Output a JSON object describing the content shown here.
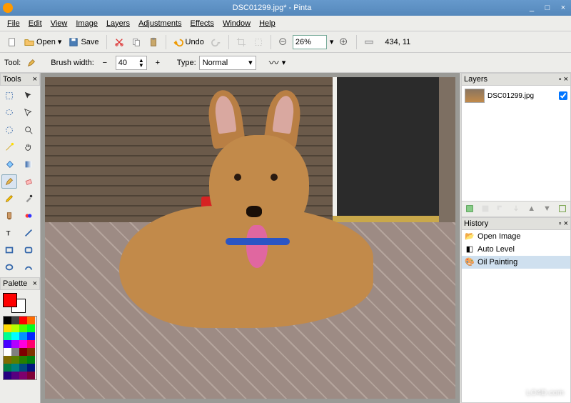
{
  "window": {
    "title": "DSC01299.jpg* - Pinta",
    "minimize": "_",
    "maximize": "□",
    "close": "×"
  },
  "menu": {
    "file": "File",
    "edit": "Edit",
    "view": "View",
    "image": "Image",
    "layers": "Layers",
    "adjustments": "Adjustments",
    "effects": "Effects",
    "window": "Window",
    "help": "Help"
  },
  "toolbar": {
    "open": "Open",
    "save": "Save",
    "undo": "Undo",
    "zoom_value": "26%",
    "coords": "434, 11"
  },
  "tool_opts": {
    "tool_label": "Tool:",
    "brush_width_label": "Brush width:",
    "brush_width": "40",
    "type_label": "Type:",
    "type_value": "Normal"
  },
  "panels": {
    "tools_title": "Tools",
    "palette_title": "Palette",
    "layers_title": "Layers",
    "history_title": "History"
  },
  "layers": {
    "items": [
      {
        "name": "DSC01299.jpg",
        "visible": true
      }
    ]
  },
  "history": {
    "items": [
      {
        "label": "Open Image",
        "icon": "open"
      },
      {
        "label": "Auto Level",
        "icon": "autolevel"
      },
      {
        "label": "Oil Painting",
        "icon": "oil",
        "selected": true
      }
    ]
  },
  "palette_colors": [
    "#000000",
    "#404040",
    "#ff0000",
    "#ff6a00",
    "#ffd800",
    "#b6ff00",
    "#4cff00",
    "#00ff21",
    "#00ff90",
    "#00ffff",
    "#0094ff",
    "#0026ff",
    "#4800ff",
    "#b200ff",
    "#ff00dc",
    "#ff006e",
    "#ffffff",
    "#808080",
    "#7f0000",
    "#7f3300",
    "#7f6a00",
    "#5b7f00",
    "#267f00",
    "#007f0e",
    "#007f46",
    "#007f7f",
    "#004a7f",
    "#00137f",
    "#24007f",
    "#57007f",
    "#7f006e",
    "#7f0037"
  ],
  "watermark": "LO4D.com"
}
